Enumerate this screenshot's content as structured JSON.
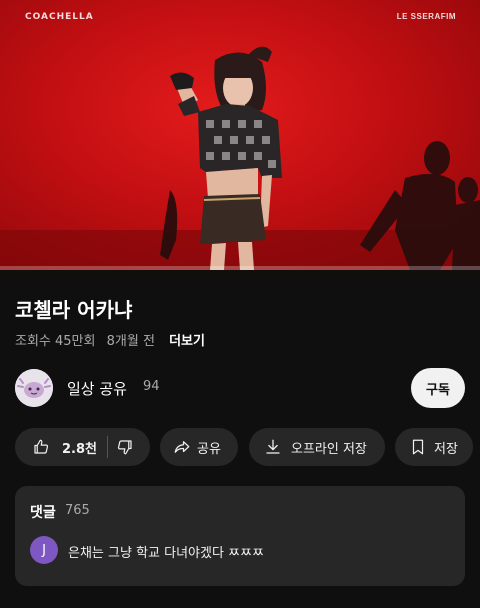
{
  "video": {
    "watermark_left": "COACHELLA",
    "watermark_right": "LE SSERAFIM",
    "progress_fraction": 0.0
  },
  "title": "코첼라 어카냐",
  "meta": {
    "views": "조회수 45만회",
    "age": "8개월 전",
    "more": "더보기"
  },
  "channel": {
    "name": "일상 공유",
    "subscribers": "94",
    "subscribe_label": "구독"
  },
  "actions": {
    "like_count": "2.8천",
    "share_label": "공유",
    "offline_label": "오프라인 저장",
    "save_label": "저장"
  },
  "comments": {
    "heading": "댓글",
    "count": "765",
    "top_comment": {
      "avatar_letter": "J",
      "avatar_color": "#7e57c2",
      "text": "은채는 그냥 학교 다녀야겠다 ㅉㅉㅉ"
    }
  },
  "colors": {
    "accent": "#ff0000",
    "chip_bg": "#272727",
    "background": "#0f0f0f"
  }
}
